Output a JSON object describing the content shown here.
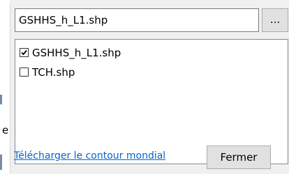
{
  "file_selector": {
    "current_value": "GSHHS_h_L1.shp",
    "browse_label": "..."
  },
  "file_list": {
    "items": [
      {
        "label": "GSHHS_h_L1.shp",
        "checked": true
      },
      {
        "label": "TCH.shp",
        "checked": false
      }
    ]
  },
  "background_fragment": {
    "glyph": "e"
  },
  "footer": {
    "download_link_label": "Télécharger le contour mondial",
    "close_label": "Fermer"
  },
  "colors": {
    "link": "#0066cc",
    "button_face": "#e1e1e1"
  }
}
